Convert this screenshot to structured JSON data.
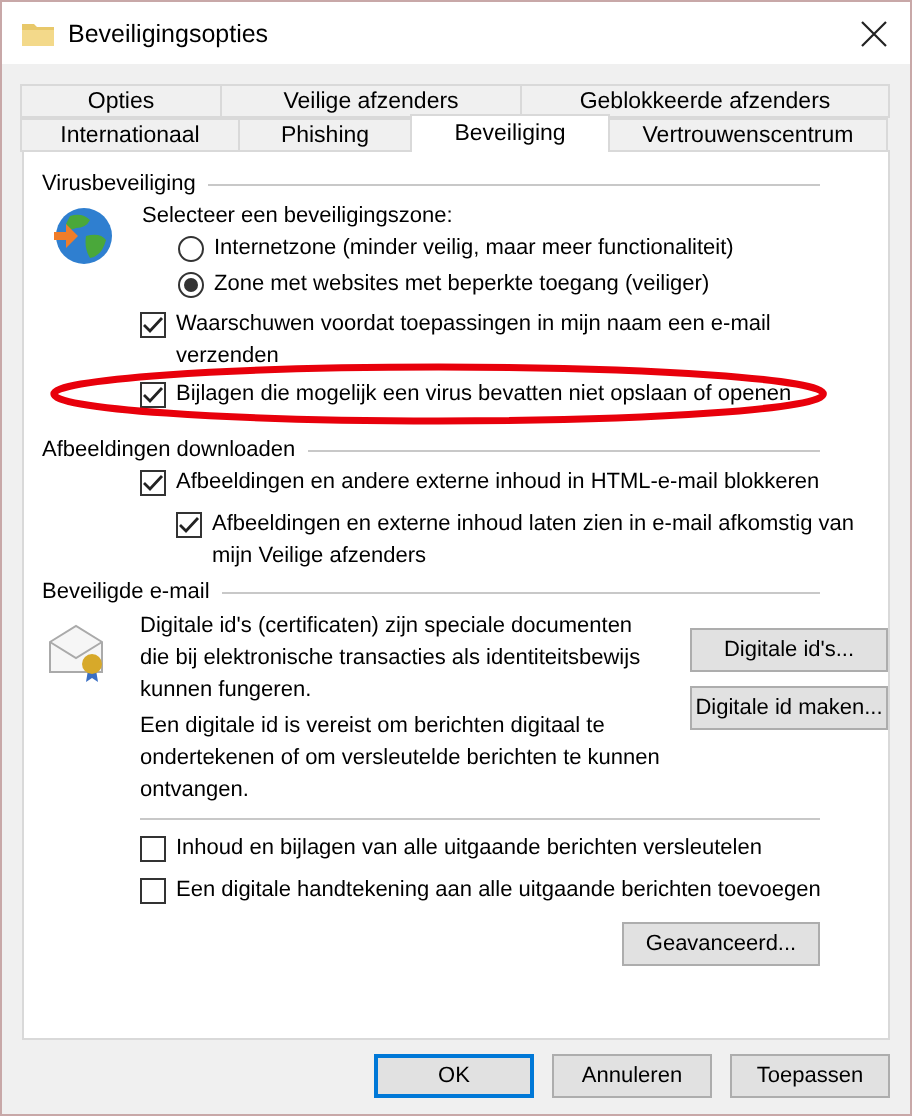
{
  "window": {
    "title": "Beveiligingsopties"
  },
  "tab_rows": [
    {
      "tabs": [
        {
          "label": "Opties",
          "selected": false
        },
        {
          "label": "Veilige afzenders",
          "selected": false
        },
        {
          "label": "Geblokkeerde afzenders",
          "selected": false
        }
      ]
    },
    {
      "tabs": [
        {
          "label": "Internationaal",
          "selected": false
        },
        {
          "label": "Phishing",
          "selected": false
        },
        {
          "label": "Beveiliging",
          "selected": true
        },
        {
          "label": "Vertrouwenscentrum",
          "selected": false
        }
      ]
    }
  ],
  "virus": {
    "header": "Virusbeveiliging",
    "prompt": "Selecteer een beveiligingszone:",
    "zones": [
      {
        "label": "Internetzone (minder veilig, maar meer functionaliteit)",
        "selected": false
      },
      {
        "label": "Zone met websites met beperkte toegang (veiliger)",
        "selected": true
      }
    ],
    "checkboxes": [
      {
        "label": "Waarschuwen voordat toepassingen in mijn naam een e-mail verzenden",
        "checked": true,
        "highlighted": false
      },
      {
        "label": "Bijlagen die mogelijk een virus bevatten niet opslaan of openen",
        "checked": true,
        "highlighted": true
      }
    ]
  },
  "images": {
    "header": "Afbeeldingen downloaden",
    "checkboxes": [
      {
        "label": "Afbeeldingen en andere externe inhoud in HTML-e-mail blokkeren",
        "checked": true,
        "children": [
          {
            "label": "Afbeeldingen en externe inhoud laten zien in e-mail afkomstig van mijn Veilige afzenders",
            "checked": true
          }
        ]
      }
    ]
  },
  "secure_email": {
    "header": "Beveiligde e-mail",
    "paragraphs": [
      "Digitale id's (certificaten) zijn speciale documenten die bij elektronische transacties als identiteitsbewijs kunnen fungeren.",
      "Een digitale id is vereist om berichten digitaal te ondertekenen of om versleutelde berichten te kunnen ontvangen."
    ],
    "buttons": [
      "Digitale id's...",
      "Digitale id maken..."
    ],
    "checkboxes": [
      {
        "label": "Inhoud en bijlagen van alle uitgaande berichten versleutelen",
        "checked": false
      },
      {
        "label": "Een digitale handtekening aan alle uitgaande berichten toevoegen",
        "checked": false
      }
    ],
    "advanced_button": "Geavanceerd..."
  },
  "buttons": [
    {
      "label": "OK",
      "kind": "default"
    },
    {
      "label": "Annuleren",
      "kind": "normal"
    },
    {
      "label": "Toepassen",
      "kind": "normal"
    }
  ]
}
